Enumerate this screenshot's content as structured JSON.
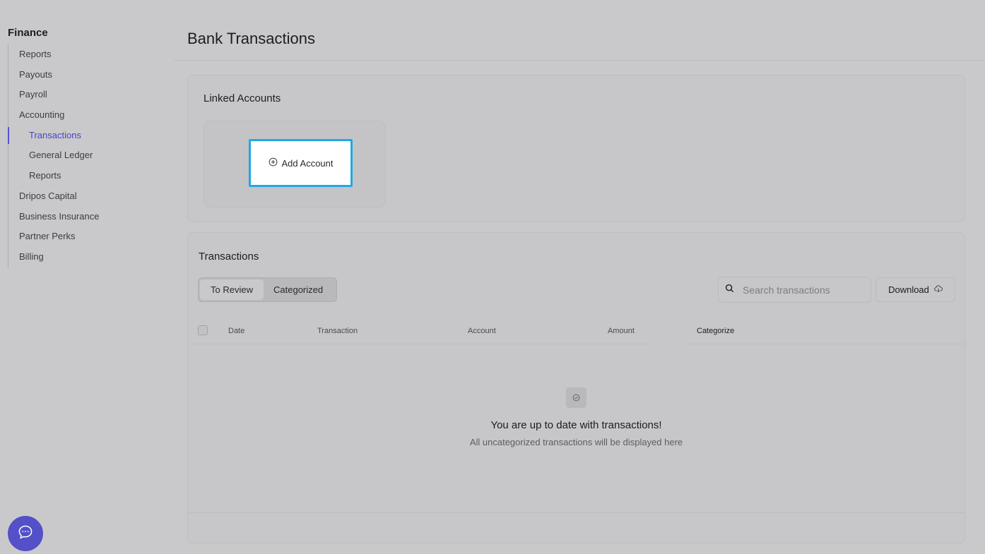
{
  "sidebar": {
    "title": "Finance",
    "items": [
      {
        "label": "Reports"
      },
      {
        "label": "Payouts"
      },
      {
        "label": "Payroll"
      },
      {
        "label": "Accounting"
      },
      {
        "label": "Transactions"
      },
      {
        "label": "General Ledger"
      },
      {
        "label": "Reports"
      },
      {
        "label": "Dripos Capital"
      },
      {
        "label": "Business Insurance"
      },
      {
        "label": "Partner Perks"
      },
      {
        "label": "Billing"
      }
    ]
  },
  "header": {
    "title": "Bank Transactions"
  },
  "linked_accounts": {
    "title": "Linked Accounts",
    "add_button_label": "Add Account",
    "add_icon": "plus-circle-icon"
  },
  "transactions": {
    "title": "Transactions",
    "tabs": [
      {
        "label": "To Review",
        "selected": true
      },
      {
        "label": "Categorized",
        "selected": false
      }
    ],
    "search": {
      "placeholder": "Search transactions",
      "value": ""
    },
    "download_label": "Download",
    "columns": [
      "Date",
      "Transaction",
      "Account",
      "Amount",
      "Categorize"
    ],
    "empty_title": "You are up to date with transactions!",
    "empty_subtitle": "All uncategorized transactions will be displayed here"
  },
  "colors": {
    "accent": "#4b42c7",
    "highlight_border": "#22a7e8",
    "chat_button": "#5450c8",
    "background": "#c9c9cb"
  }
}
